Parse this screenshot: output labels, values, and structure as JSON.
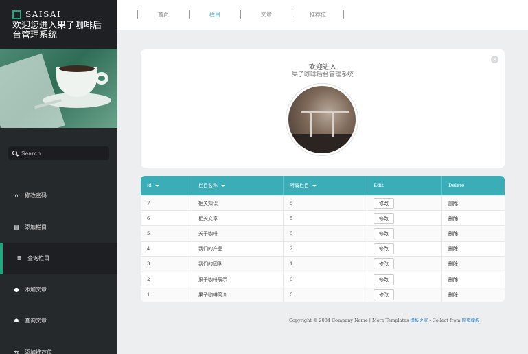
{
  "brand": {
    "name": "SAISAI",
    "subtitle": "欢迎您进入果子咖啡后台管理系统"
  },
  "search": {
    "placeholder": "Search"
  },
  "nav": {
    "items": [
      {
        "label": "修改密码",
        "icon": "home-icon",
        "glyph": "⌂"
      },
      {
        "label": "添加栏目",
        "icon": "bar-chart-icon",
        "glyph": "▤"
      },
      {
        "label": "查询栏目",
        "icon": "database-icon",
        "glyph": "≣",
        "active": true
      },
      {
        "label": "添加文章",
        "icon": "map-marker-icon",
        "glyph": "●"
      },
      {
        "label": "查询文章",
        "icon": "users-icon",
        "glyph": "☗"
      },
      {
        "label": "添加推荐位",
        "icon": "sliders-icon",
        "glyph": "⇆"
      }
    ]
  },
  "topbar": {
    "tabs": [
      {
        "label": "首页"
      },
      {
        "label": "栏目",
        "active": true
      },
      {
        "label": "文章"
      },
      {
        "label": "推荐位"
      }
    ]
  },
  "welcome": {
    "title": "欢迎进入",
    "subtitle": "果子咖啡后台管理系统",
    "close_glyph": "×"
  },
  "table": {
    "headers": [
      "id",
      "栏目名称",
      "所属栏目",
      "Edit",
      "Delete"
    ],
    "rows": [
      {
        "id": "7",
        "name": "相关知识",
        "parent": "5",
        "edit": "修改",
        "delete": "删除"
      },
      {
        "id": "6",
        "name": "相关文章",
        "parent": "5",
        "edit": "修改",
        "delete": "删除"
      },
      {
        "id": "5",
        "name": "关于咖啡",
        "parent": "0",
        "edit": "修改",
        "delete": "删除"
      },
      {
        "id": "4",
        "name": "我们的产品",
        "parent": "2",
        "edit": "修改",
        "delete": "删除"
      },
      {
        "id": "3",
        "name": "我们的团队",
        "parent": "1",
        "edit": "修改",
        "delete": "删除"
      },
      {
        "id": "2",
        "name": "果子咖啡展示",
        "parent": "0",
        "edit": "修改",
        "delete": "删除"
      },
      {
        "id": "1",
        "name": "果子咖啡简介",
        "parent": "0",
        "edit": "修改",
        "delete": "删除"
      }
    ]
  },
  "footer": {
    "copyright": "Copyright © 2084 Company Name | More Templates ",
    "link1": "模板之家",
    "middle": " - Collect from ",
    "link2": "网页模板"
  },
  "colors": {
    "accent": "#3aadb7",
    "sidebar": "#26292c",
    "active_indicator": "#1fa67a"
  }
}
